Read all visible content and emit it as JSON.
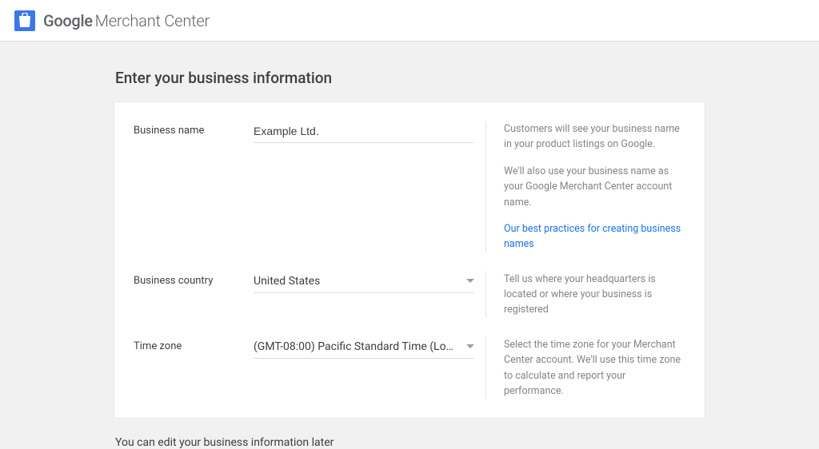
{
  "header": {
    "brand_google": "Google",
    "brand_product": "Merchant Center"
  },
  "page": {
    "heading": "Enter your business information",
    "footer_note": "You can edit your business information later"
  },
  "fields": {
    "business_name": {
      "label": "Business name",
      "value": "Example Ltd.",
      "help1": "Customers will see your business name in your product listings on Google.",
      "help2": "We'll also use your business name as your Google Merchant Center account name.",
      "help_link": "Our best practices for creating business names"
    },
    "business_country": {
      "label": "Business country",
      "value": "United States",
      "help": "Tell us where your headquarters is located or where your business is registered"
    },
    "time_zone": {
      "label": "Time zone",
      "value": "(GMT-08:00) Pacific Standard Time (Lo…",
      "help": "Select the time zone for your Merchant Center account. We'll use this time zone to calculate and report your performance."
    }
  }
}
